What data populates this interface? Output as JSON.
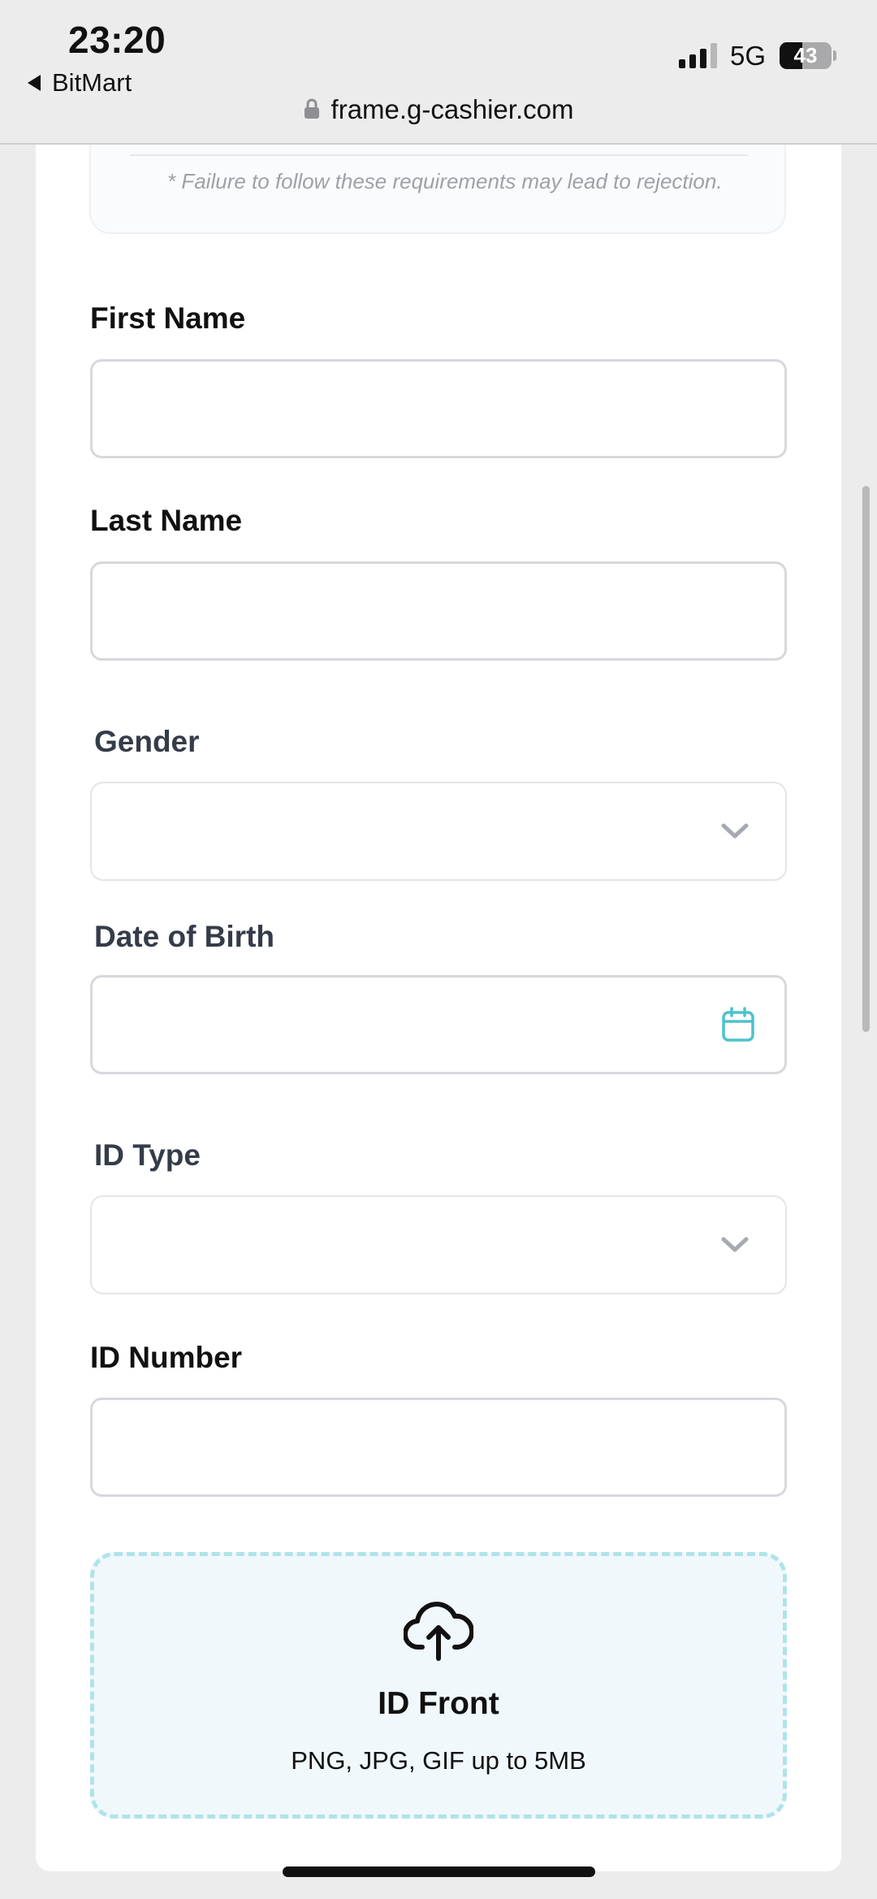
{
  "status_bar": {
    "time": "23:20",
    "back_app": "BitMart",
    "network": "5G",
    "battery_level": "43",
    "battery_percent": 43,
    "url": "frame.g-cashier.com"
  },
  "requirements": {
    "note": "* Failure to follow these requirements may lead to rejection."
  },
  "form": {
    "first_name": {
      "label": "First Name",
      "value": ""
    },
    "last_name": {
      "label": "Last Name",
      "value": ""
    },
    "gender": {
      "label": "Gender",
      "value": ""
    },
    "date_of_birth": {
      "label": "Date of Birth",
      "value": ""
    },
    "id_type": {
      "label": "ID Type",
      "value": ""
    },
    "id_number": {
      "label": "ID Number",
      "value": ""
    }
  },
  "upload": {
    "title": "ID Front",
    "hint": "PNG, JPG, GIF up to 5MB"
  },
  "icons": {
    "calendar": "calendar-icon",
    "chevron": "chevron-down-icon",
    "upload": "cloud-upload-icon",
    "lock": "lock-icon"
  },
  "colors": {
    "accent": "#4cc3cc",
    "upload_border": "#b0e3ea",
    "upload_bg": "#f0f8fb",
    "chevron": "#a6a9b0"
  }
}
